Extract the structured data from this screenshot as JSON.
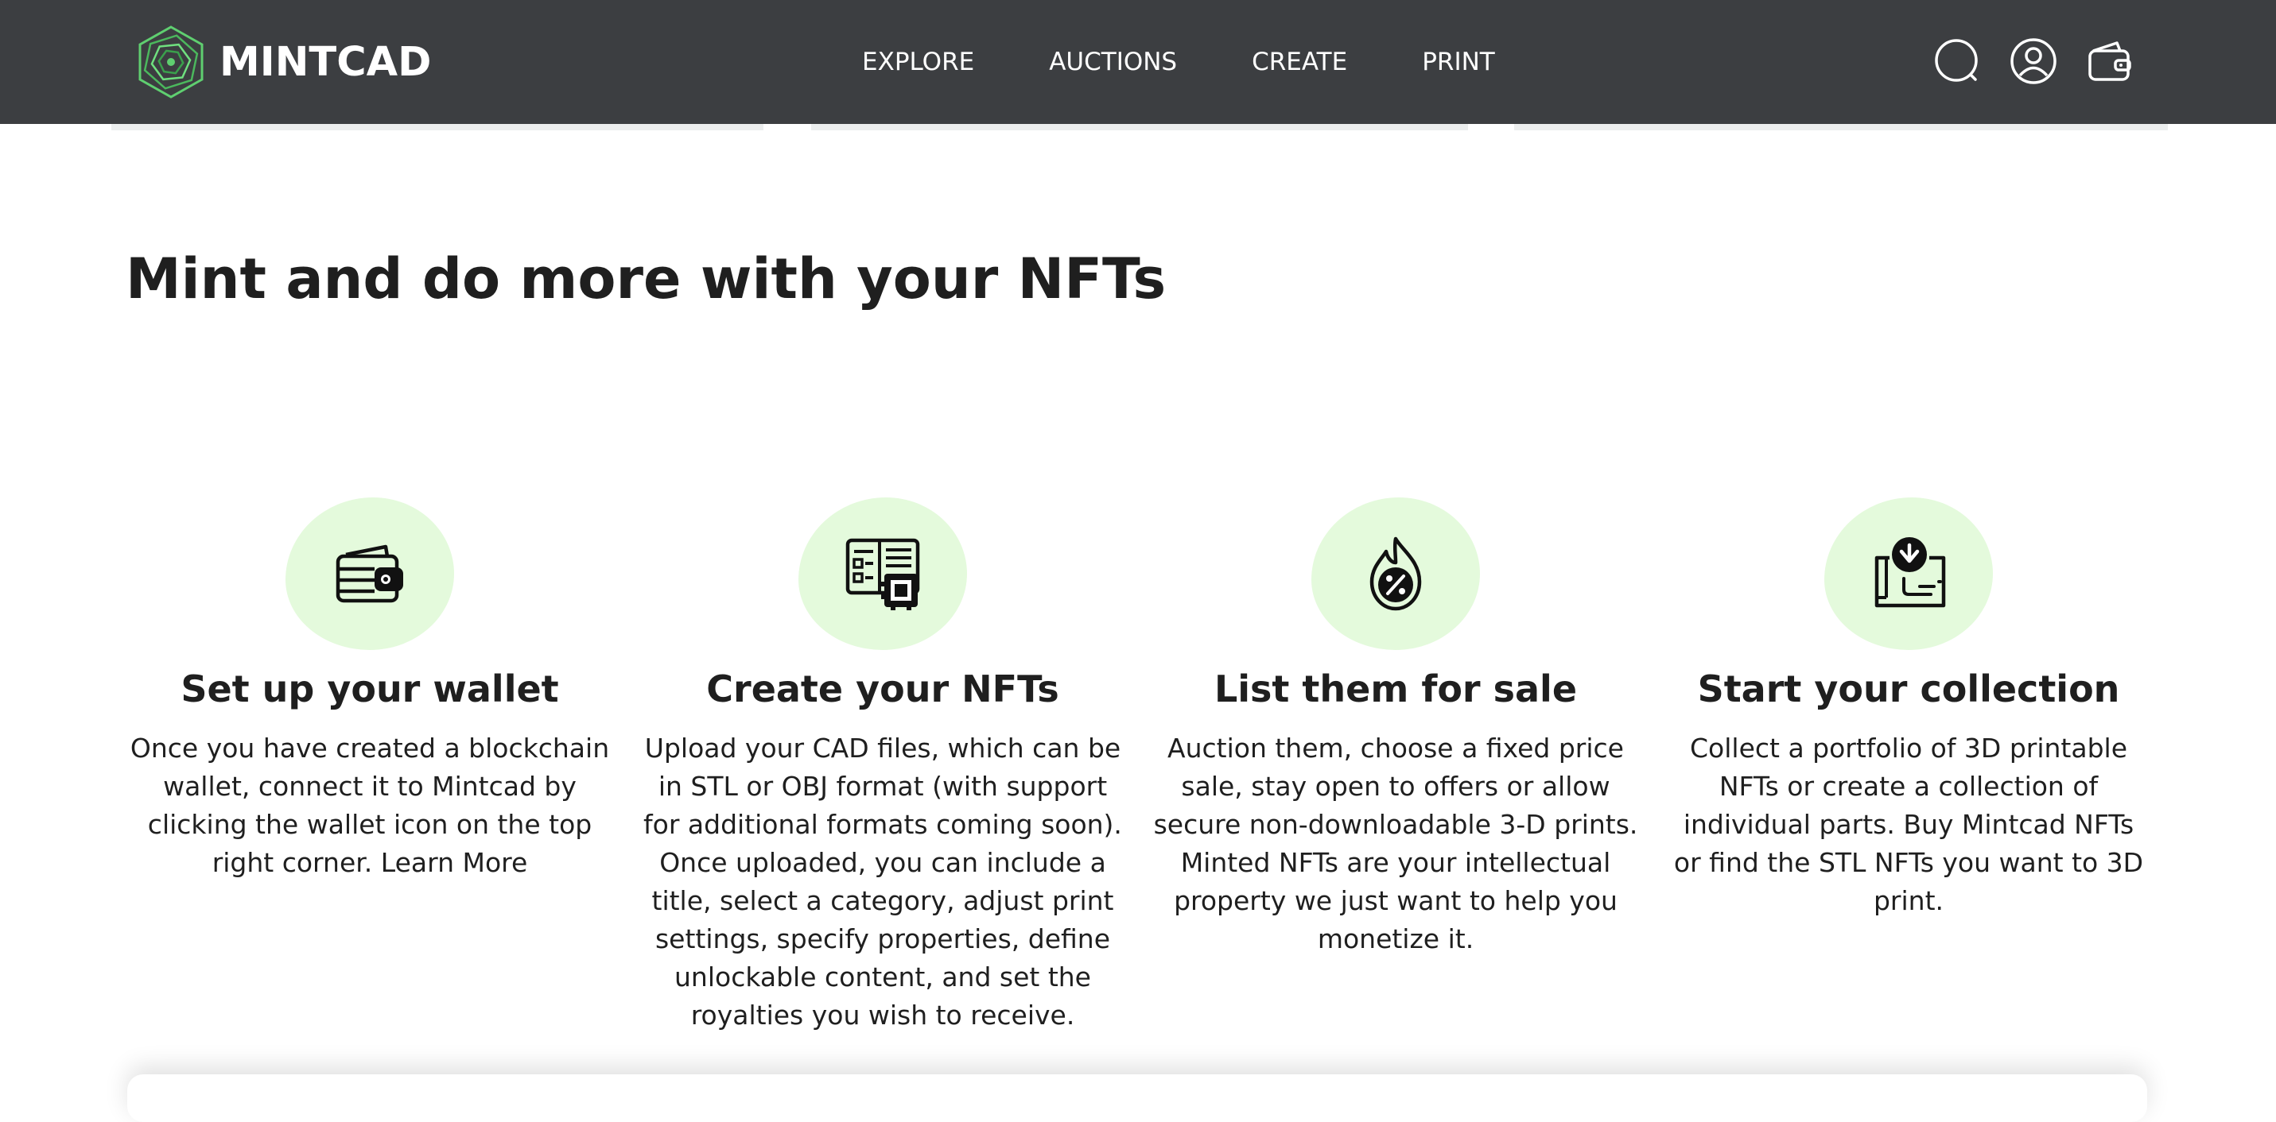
{
  "brand": {
    "name": "MINTCAD",
    "logo_icon": "spiral-hexagon-logo"
  },
  "nav": {
    "links": [
      "EXPLORE",
      "AUCTIONS",
      "CREATE",
      "PRINT"
    ],
    "icons": [
      "search-icon",
      "user-icon",
      "wallet-icon"
    ]
  },
  "main": {
    "headline": "Mint and do more with your NFTs",
    "features": [
      {
        "icon": "wallet-icon",
        "title": "Set up your wallet",
        "text": "Once you have created a blockchain wallet, connect it to Mintcad by clicking the wallet icon on the top right corner. Learn More"
      },
      {
        "icon": "cad-file-icon",
        "title": "Create your NFTs",
        "text": "Upload your CAD files, which can be in STL or OBJ format (with support for additional formats coming soon). Once uploaded, you can include a title, select a category, adjust print settings, specify properties, define unlockable content, and set the royalties you wish to receive."
      },
      {
        "icon": "percent-flame-icon",
        "title": "List them for sale",
        "text": "Auction them, choose a fixed price sale, stay open to offers or allow secure non-downloadable 3-D prints. Minted NFTs are your intellectual property we just want to help you monetize it."
      },
      {
        "icon": "collection-download-icon",
        "title": "Start your collection",
        "text": "Collect a portfolio of 3D printable NFTs or create a collection of individual parts. Buy Mintcad NFTs or find the STL NFTs you want to 3D print."
      }
    ]
  },
  "colors": {
    "navbar": "#3c3e41",
    "accent_blob": "#e4fadc",
    "logo_green": "#5fcf70",
    "text": "#1f1f1f"
  }
}
